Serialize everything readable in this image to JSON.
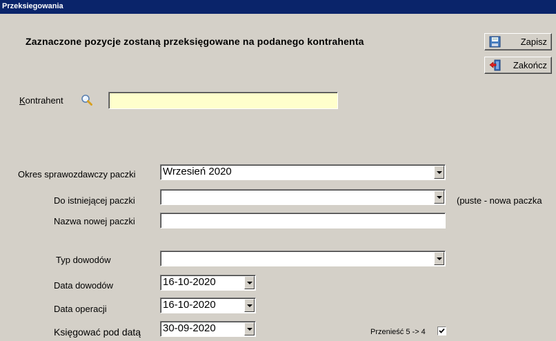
{
  "window": {
    "title": "Przeksiegowania"
  },
  "header": {
    "message": "Zaznaczone pozycje zostaną przeksięgowane na podanego kontrahenta"
  },
  "buttons": {
    "save": "Zapisz",
    "close": "Zakończ"
  },
  "contractor": {
    "label_first": "K",
    "label_rest": "ontrahent",
    "value": ""
  },
  "form": {
    "period_label": "Okres sprawozdawczy paczki",
    "period_value": "Wrzesień 2020",
    "existing_label": "Do istniejącej paczki",
    "existing_value": "",
    "existing_hint": "(puste - nowa paczka",
    "newname_label": "Nazwa nowej paczki",
    "newname_value": "",
    "doctype_label": "Typ dowodów",
    "doctype_value": "",
    "docdate_label": "Data dowodów",
    "docdate_value": "16-10-2020",
    "opdate_label": "Data operacji",
    "opdate_value": "16-10-2020",
    "postdate_label": "Księgować pod datą",
    "postdate_value": "30-09-2020",
    "move_label": "Przenieść 5 -> 4",
    "move_checked": true
  },
  "icons": {
    "save": "floppy-disk-icon",
    "close": "exit-door-icon",
    "search": "magnifier-icon"
  }
}
